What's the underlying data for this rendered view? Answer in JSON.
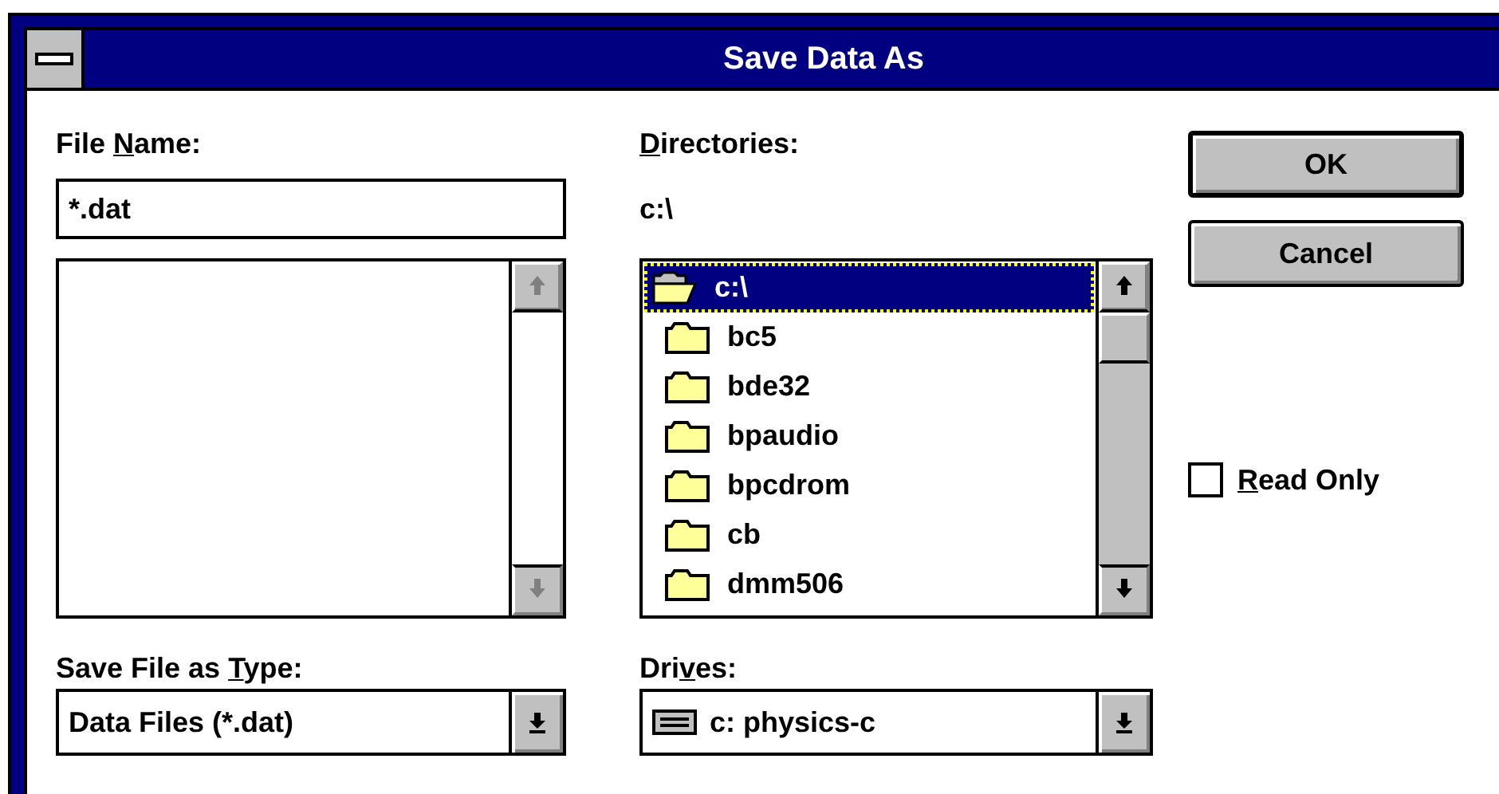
{
  "window": {
    "title": "Save Data As"
  },
  "file_name": {
    "label": [
      {
        "text": "File ",
        "underlined": false
      },
      {
        "text": "N",
        "underlined": true
      },
      {
        "text": "ame:",
        "underlined": false
      }
    ],
    "value": "*.dat"
  },
  "file_list": {
    "scrollbar_disabled": true
  },
  "directories": {
    "label": [
      {
        "text": "D",
        "underlined": true
      },
      {
        "text": "irectories:",
        "underlined": false
      }
    ],
    "path": "c:\\",
    "items": [
      {
        "name": "c:\\",
        "kind": "open",
        "selected": true
      },
      {
        "name": "bc5",
        "kind": "closed",
        "selected": false
      },
      {
        "name": "bde32",
        "kind": "closed",
        "selected": false
      },
      {
        "name": "bpaudio",
        "kind": "closed",
        "selected": false
      },
      {
        "name": "bpcdrom",
        "kind": "closed",
        "selected": false
      },
      {
        "name": "cb",
        "kind": "closed",
        "selected": false
      },
      {
        "name": "dmm506",
        "kind": "closed",
        "selected": false
      }
    ]
  },
  "save_type": {
    "label": [
      {
        "text": "Save File as ",
        "underlined": false
      },
      {
        "text": "T",
        "underlined": true
      },
      {
        "text": "ype:",
        "underlined": false
      }
    ],
    "value": "Data Files (*.dat)"
  },
  "drives": {
    "label": [
      {
        "text": "Dri",
        "underlined": false
      },
      {
        "text": "v",
        "underlined": true
      },
      {
        "text": "es:",
        "underlined": false
      }
    ],
    "value": "c: physics-c"
  },
  "buttons": [
    {
      "label": "OK",
      "default": true
    },
    {
      "label": "Cancel",
      "default": false
    }
  ],
  "read_only": {
    "label": [
      {
        "text": "R",
        "underlined": true
      },
      {
        "text": "ead Only",
        "underlined": false
      }
    ],
    "checked": false
  }
}
